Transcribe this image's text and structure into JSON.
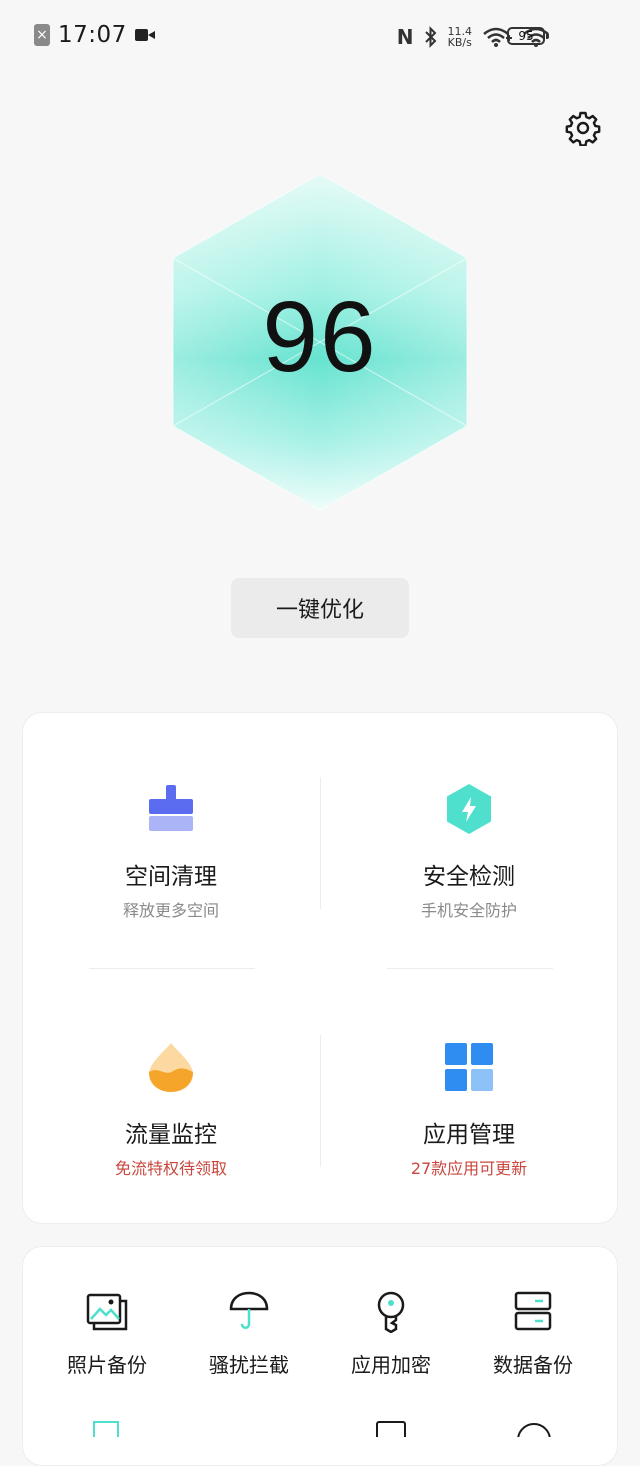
{
  "status_bar": {
    "time": "17:07",
    "net_speed_value": "11.4",
    "net_speed_unit": "KB/s",
    "battery": "95"
  },
  "score": {
    "value": "96"
  },
  "optimize_button": {
    "label": "一键优化"
  },
  "features": [
    {
      "title": "空间清理",
      "subtitle": "释放更多空间",
      "icon": "broom-icon"
    },
    {
      "title": "安全检测",
      "subtitle": "手机安全防护",
      "icon": "shield-bolt-icon"
    },
    {
      "title": "流量监控",
      "subtitle": "免流特权待领取",
      "icon": "water-drop-icon"
    },
    {
      "title": "应用管理",
      "subtitle": "27款应用可更新",
      "icon": "app-grid-icon"
    }
  ],
  "tools": [
    {
      "label": "照片备份",
      "icon": "photo-icon"
    },
    {
      "label": "骚扰拦截",
      "icon": "umbrella-icon"
    },
    {
      "label": "应用加密",
      "icon": "key-icon"
    },
    {
      "label": "数据备份",
      "icon": "storage-icon"
    }
  ],
  "colors": {
    "accent_teal": "#5ee3cf",
    "clean_blue": "#5b6cf0",
    "safety_teal": "#4ee0cc",
    "traffic_orange": "#f5a52a",
    "apps_blue": "#2f8cf0",
    "warning_red": "#c9473e"
  }
}
